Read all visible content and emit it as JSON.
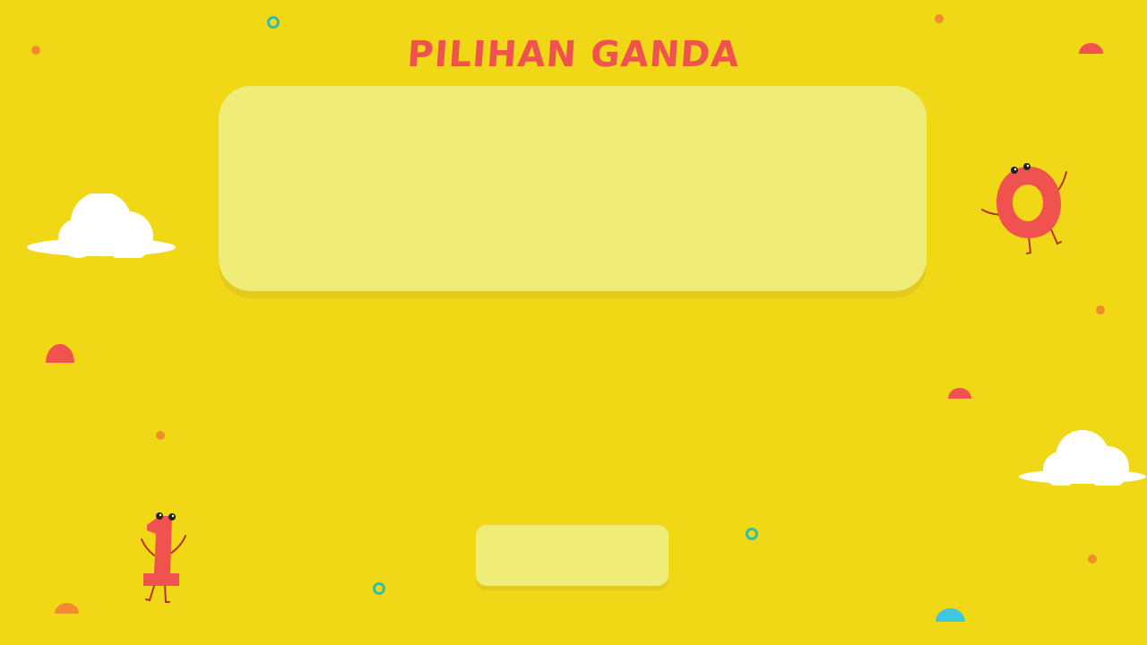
{
  "game": {
    "title": "PILIHAN GANDA",
    "question_text": "",
    "answer_button_label": ""
  },
  "colors": {
    "background": "#F0D816",
    "title": "#F0524F",
    "card": "#F0EC78",
    "card_shadow": "#E5CA1E",
    "orange_dot": "#F08C2A",
    "teal_ring": "#2FBFA8",
    "red_dome": "#F0524F",
    "orange_dome": "#F58A2E",
    "blue_dome": "#3FC6E0",
    "cloud": "#FFFFFF",
    "character": "#F0524F",
    "character_limb": "#B8302C"
  },
  "icons": {
    "zero": "number-zero-character-icon",
    "one": "number-one-character-icon",
    "cloud": "cloud-icon"
  }
}
